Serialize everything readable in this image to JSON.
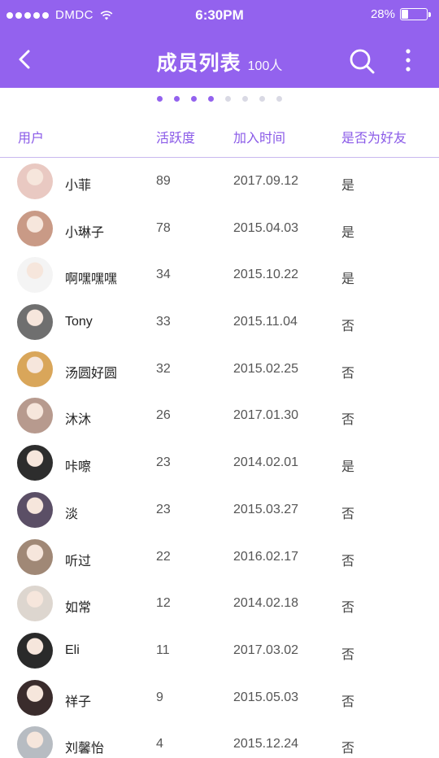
{
  "status_bar": {
    "carrier": "DMDC",
    "time": "6:30PM",
    "battery": "28%"
  },
  "nav": {
    "title": "成员列表",
    "member_count": "100人",
    "back_icon": "chevron-left-icon",
    "search_icon": "search-icon",
    "more_icon": "more-vertical-icon"
  },
  "pager": {
    "total": 8,
    "active": 4,
    "active_color": "#9362ee",
    "inactive_color": "#d9d9e4"
  },
  "table": {
    "headers": {
      "user": "用户",
      "activity": "活跃度",
      "join_time": "加入时间",
      "is_friend": "是否为好友"
    },
    "rows": [
      {
        "name": "小菲",
        "activity": "89",
        "join_time": "2017.09.12",
        "is_friend": "是",
        "avatar_color": "#e9c9c2"
      },
      {
        "name": "小琳子",
        "activity": "78",
        "join_time": "2015.04.03",
        "is_friend": "是",
        "avatar_color": "#c99a86"
      },
      {
        "name": "啊嘿嘿嘿",
        "activity": "34",
        "join_time": "2015.10.22",
        "is_friend": "是",
        "avatar_color": "#f4f4f4"
      },
      {
        "name": "Tony",
        "activity": "33",
        "join_time": "2015.11.04",
        "is_friend": "否",
        "avatar_color": "#6f6f6f"
      },
      {
        "name": "汤圆好圆",
        "activity": "32",
        "join_time": "2015.02.25",
        "is_friend": "否",
        "avatar_color": "#d9a65a"
      },
      {
        "name": "沐沐",
        "activity": "26",
        "join_time": "2017.01.30",
        "is_friend": "否",
        "avatar_color": "#b79a8e"
      },
      {
        "name": "咔嚓",
        "activity": "23",
        "join_time": "2014.02.01",
        "is_friend": "是",
        "avatar_color": "#2d2d2d"
      },
      {
        "name": "淡",
        "activity": "23",
        "join_time": "2015.03.27",
        "is_friend": "否",
        "avatar_color": "#5b4f66"
      },
      {
        "name": "听过",
        "activity": "22",
        "join_time": "2016.02.17",
        "is_friend": "否",
        "avatar_color": "#a08876"
      },
      {
        "name": "如常",
        "activity": "12",
        "join_time": "2014.02.18",
        "is_friend": "否",
        "avatar_color": "#ddd6cf"
      },
      {
        "name": "Eli",
        "activity": "11",
        "join_time": "2017.03.02",
        "is_friend": "否",
        "avatar_color": "#2a2a2a"
      },
      {
        "name": "祥子",
        "activity": "9",
        "join_time": "2015.05.03",
        "is_friend": "否",
        "avatar_color": "#3a2c2c"
      },
      {
        "name": "刘馨怡",
        "activity": "4",
        "join_time": "2015.12.24",
        "is_friend": "否",
        "avatar_color": "#b7bcc2"
      }
    ]
  }
}
